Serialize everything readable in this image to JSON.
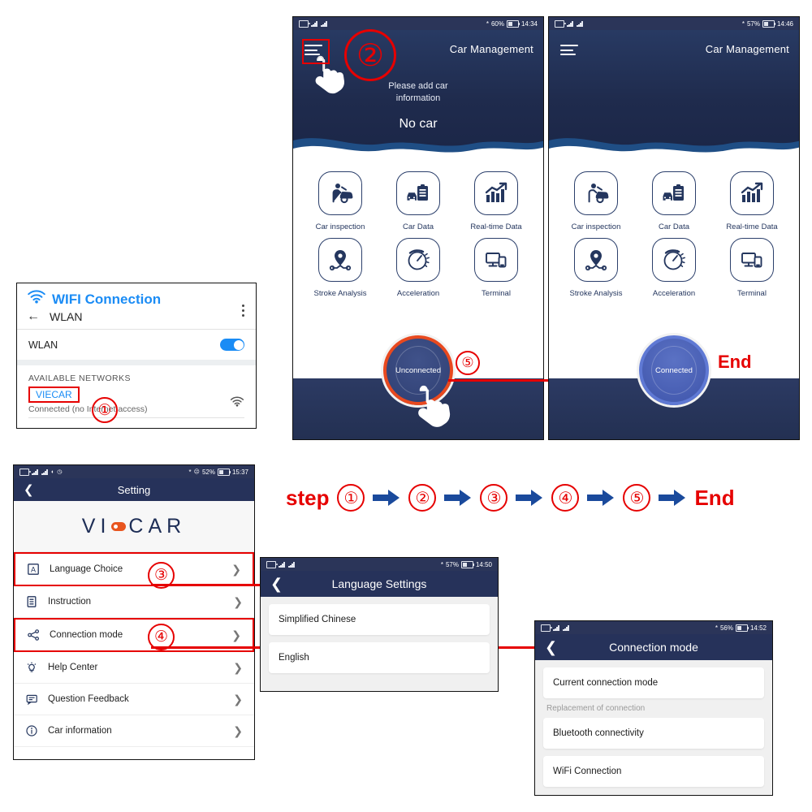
{
  "meta": {
    "accent_red": "#e60000",
    "accent_blue": "#1a4a9c",
    "navy": "#26325a",
    "orange": "#e8551f"
  },
  "wifi_panel": {
    "title": "WIFI Connection",
    "back_icon": "back-arrow-icon",
    "screen_title": "WLAN",
    "menu_icon": "kebab-menu-icon",
    "toggle_label": "WLAN",
    "toggle_state": "on",
    "section_label": "AVAILABLE NETWORKS",
    "network_name": "VIECAR",
    "network_status": "Connected (no Internet access)",
    "network_icon": "wifi-icon",
    "step_badge": "①"
  },
  "phone_a": {
    "status": {
      "time": "14:34",
      "battery": "60%",
      "bluetooth_icon": "bluetooth-icon"
    },
    "menu_icon": "hamburger-menu-icon",
    "title": "Car Management",
    "subtitle": "Please add car\ninformation",
    "subtitle_line1": "Please add car",
    "subtitle_line2": "information",
    "no_car": "No car",
    "tiles": [
      {
        "label": "Car inspection",
        "icon": "car-inspection-icon"
      },
      {
        "label": "Car Data",
        "icon": "car-data-icon"
      },
      {
        "label": "Real-time Data",
        "icon": "realtime-chart-icon"
      },
      {
        "label": "Stroke Analysis",
        "icon": "location-pin-icon"
      },
      {
        "label": "Acceleration",
        "icon": "speedometer-icon"
      },
      {
        "label": "Terminal",
        "icon": "terminal-devices-icon"
      }
    ],
    "connect_button": "Unconnected",
    "step_badge": "②",
    "step_badge_button": "⑤"
  },
  "phone_b": {
    "status": {
      "time": "14:46",
      "battery": "57%",
      "bluetooth_icon": "bluetooth-icon"
    },
    "menu_icon": "hamburger-menu-icon",
    "title": "Car Management",
    "tiles": [
      {
        "label": "Car inspection",
        "icon": "car-inspection-icon"
      },
      {
        "label": "Car Data",
        "icon": "car-data-icon"
      },
      {
        "label": "Real-time Data",
        "icon": "realtime-chart-icon"
      },
      {
        "label": "Stroke Analysis",
        "icon": "location-pin-icon"
      },
      {
        "label": "Acceleration",
        "icon": "speedometer-icon"
      },
      {
        "label": "Terminal",
        "icon": "terminal-devices-icon"
      }
    ],
    "connect_button": "Connected",
    "end_label": "End"
  },
  "setting_panel": {
    "status": {
      "time": "15:37",
      "battery": "52%",
      "bluetooth_icon": "bluetooth-icon",
      "mute_icon": "mute-icon",
      "alarm_icon": "alarm-icon",
      "wifi_icon": "wifi-icon"
    },
    "back_icon": "back-chevron-icon",
    "title": "Setting",
    "logo_text_left": "VI",
    "logo_text_right": "CAR",
    "rows": [
      {
        "label": "Language Choice",
        "icon": "language-a-icon",
        "highlight": true,
        "badge": "③"
      },
      {
        "label": "Instruction",
        "icon": "document-icon",
        "highlight": false,
        "badge": ""
      },
      {
        "label": "Connection mode",
        "icon": "share-nodes-icon",
        "highlight": true,
        "badge": "④"
      },
      {
        "label": "Help Center",
        "icon": "lightbulb-icon",
        "highlight": false,
        "badge": ""
      },
      {
        "label": "Question Feedback",
        "icon": "feedback-bubble-icon",
        "highlight": false,
        "badge": ""
      },
      {
        "label": "Car information",
        "icon": "info-circle-icon",
        "highlight": false,
        "badge": ""
      }
    ]
  },
  "language_panel": {
    "status": {
      "time": "14:50",
      "battery": "57%",
      "bluetooth_icon": "bluetooth-icon"
    },
    "back_icon": "back-chevron-icon",
    "title": "Language Settings",
    "options": [
      "Simplified Chinese",
      "English"
    ]
  },
  "connection_panel": {
    "status": {
      "time": "14:52",
      "battery": "56%",
      "bluetooth_icon": "bluetooth-icon"
    },
    "back_icon": "back-chevron-icon",
    "title": "Connection mode",
    "current_item": "Current connection mode",
    "section_caption": "Replacement of connection",
    "options": [
      "Bluetooth connectivity",
      "WiFi Connection"
    ]
  },
  "step_flow": {
    "prefix": "step",
    "steps": [
      "①",
      "②",
      "③",
      "④",
      "⑤"
    ],
    "end": "End",
    "arrow_icon": "right-arrow-icon"
  }
}
